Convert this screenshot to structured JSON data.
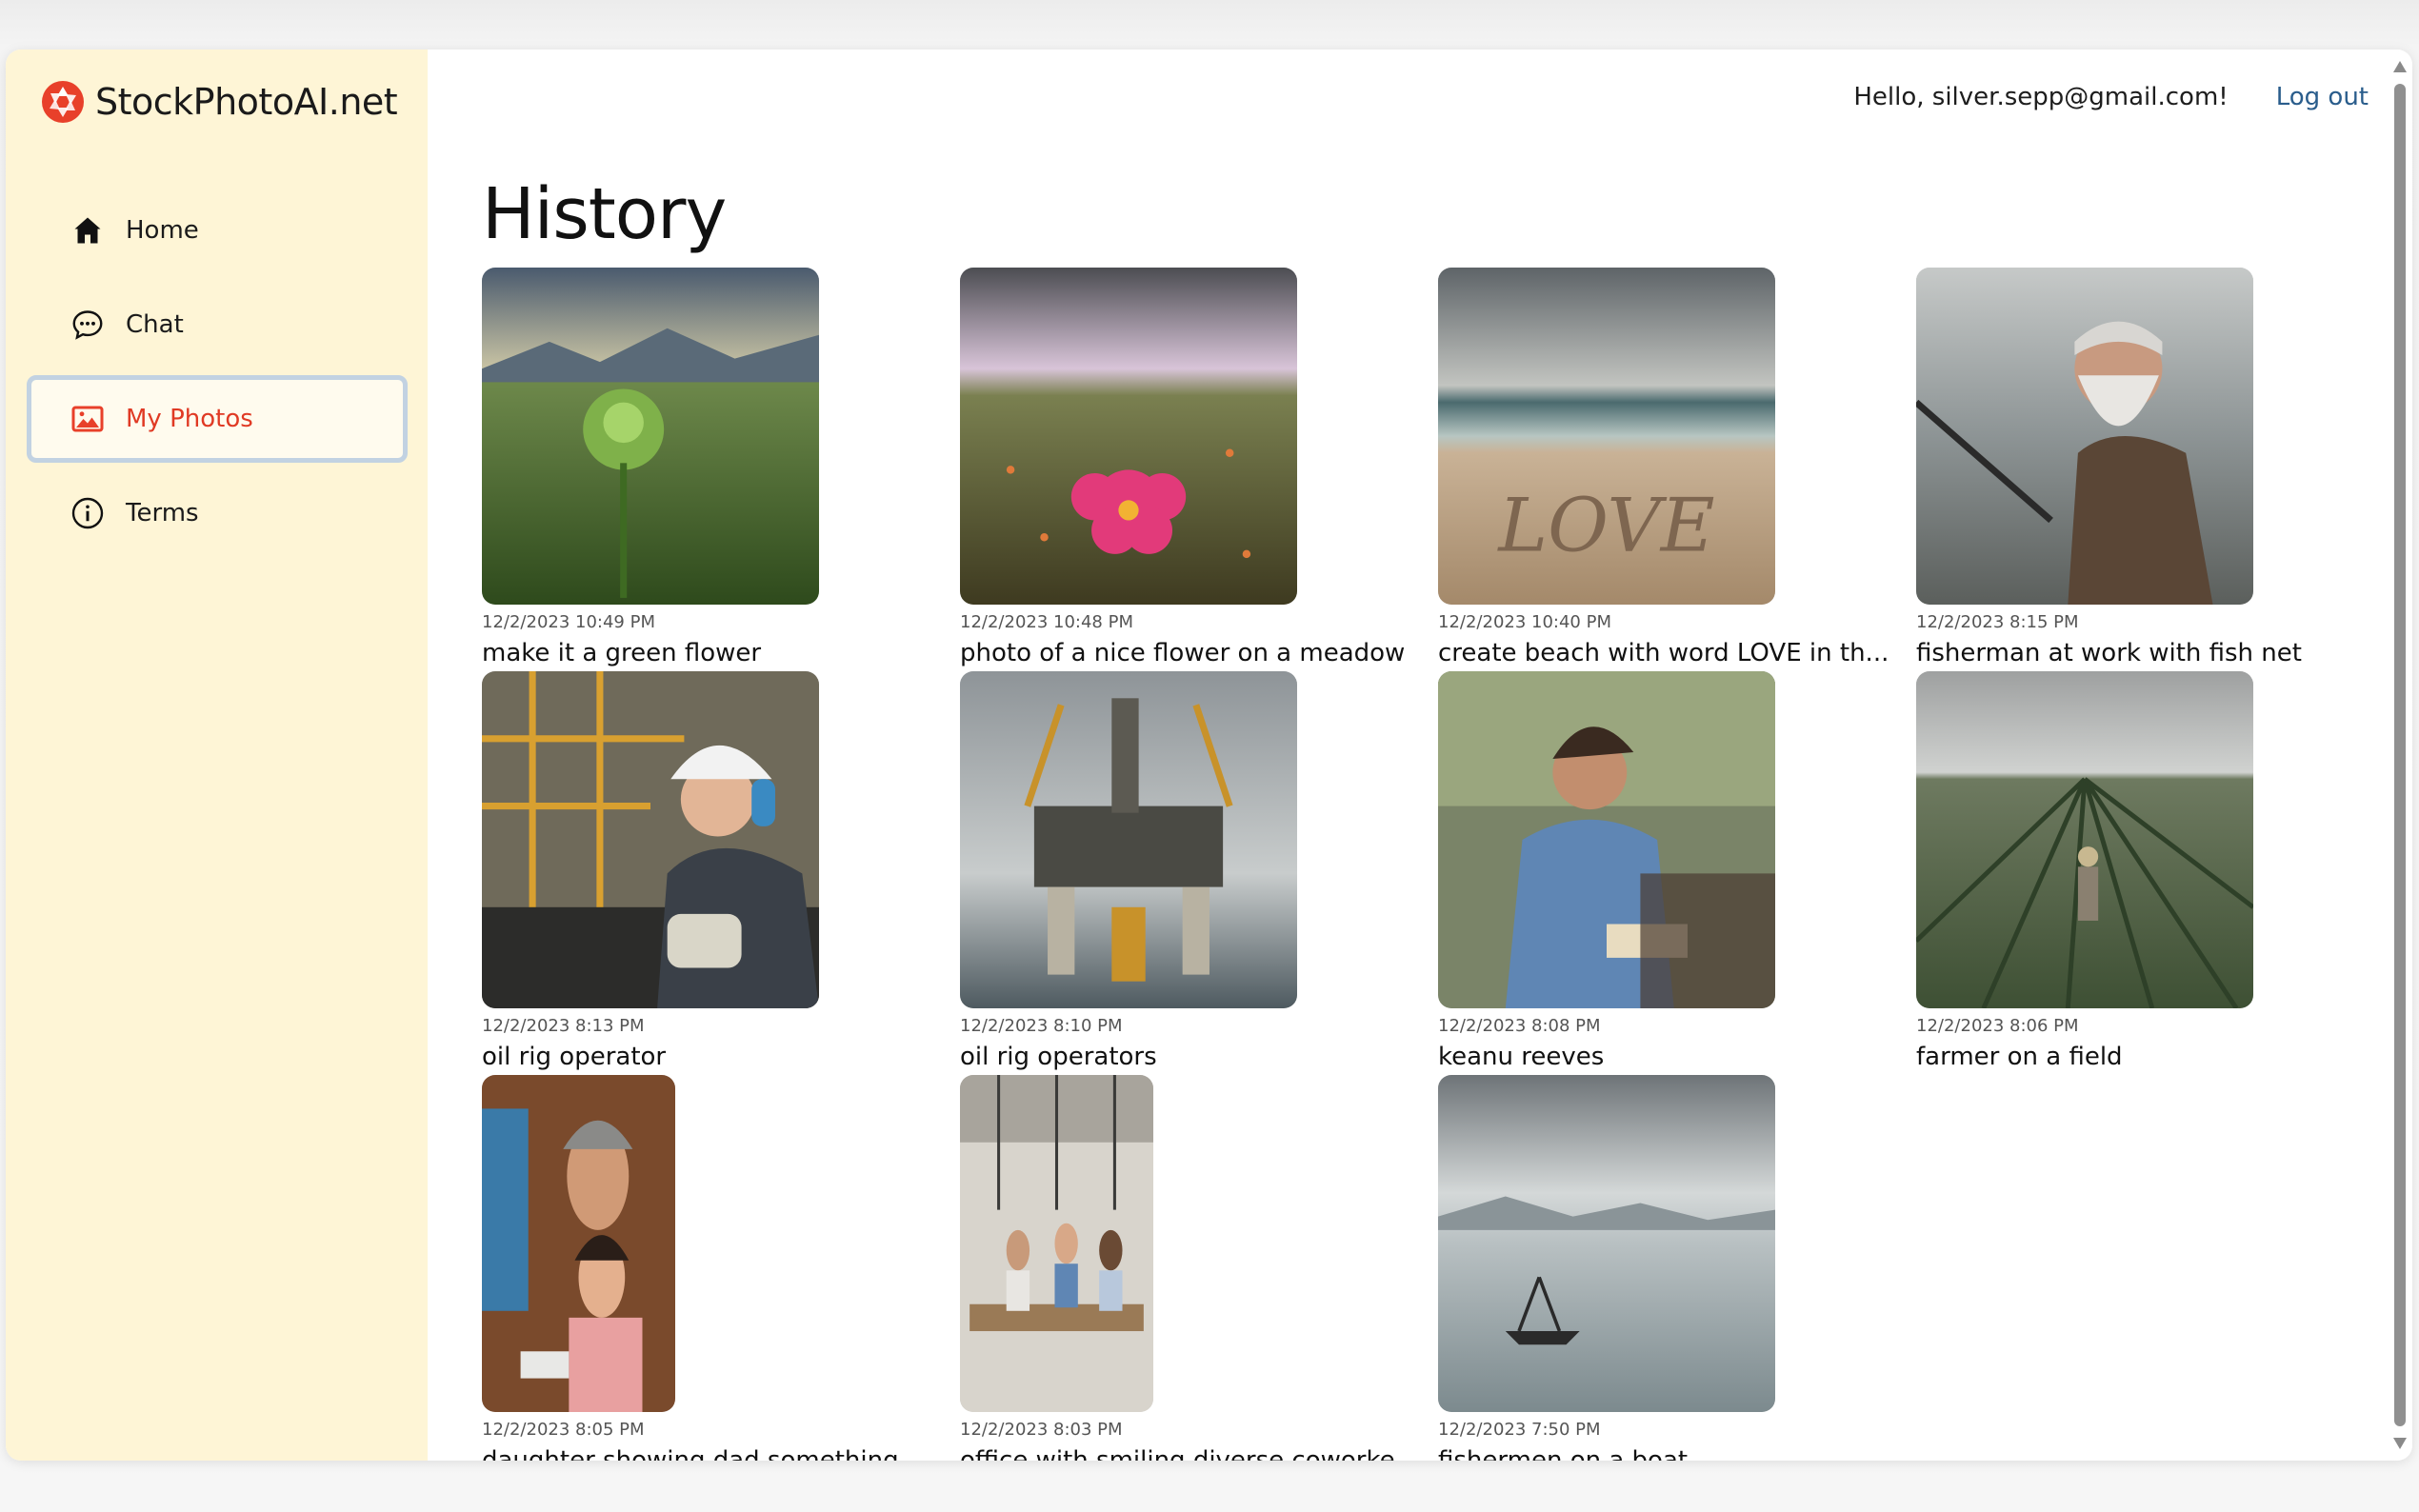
{
  "brand": {
    "name": "StockPhotoAI.net",
    "logo_icon": "aperture-logo-icon",
    "accent": "#e8402a"
  },
  "sidebar": {
    "items": [
      {
        "label": "Home",
        "icon": "home-icon",
        "active": false
      },
      {
        "label": "Chat",
        "icon": "chat-icon",
        "active": false
      },
      {
        "label": "My Photos",
        "icon": "image-icon",
        "active": true
      },
      {
        "label": "Terms",
        "icon": "info-icon",
        "active": false
      }
    ]
  },
  "header": {
    "greeting": "Hello, silver.sepp@gmail.com!",
    "logout": "Log out"
  },
  "page": {
    "title": "History"
  },
  "photos": [
    {
      "timestamp": "12/2/2023 10:49 PM",
      "prompt": "make it a green flower"
    },
    {
      "timestamp": "12/2/2023 10:48 PM",
      "prompt": "photo of a nice flower on a meadow"
    },
    {
      "timestamp": "12/2/2023 10:40 PM",
      "prompt": "create beach with word LOVE in th..."
    },
    {
      "timestamp": "12/2/2023 8:15 PM",
      "prompt": "fisherman at work with fish net"
    },
    {
      "timestamp": "12/2/2023 8:13 PM",
      "prompt": "oil rig operator"
    },
    {
      "timestamp": "12/2/2023 8:10 PM",
      "prompt": "oil rig operators"
    },
    {
      "timestamp": "12/2/2023 8:08 PM",
      "prompt": "keanu reeves"
    },
    {
      "timestamp": "12/2/2023 8:06 PM",
      "prompt": "farmer on a field"
    },
    {
      "timestamp": "12/2/2023 8:05 PM",
      "prompt": "daughter showing dad something"
    },
    {
      "timestamp": "12/2/2023 8:03 PM",
      "prompt": "office with smiling diverse coworke"
    },
    {
      "timestamp": "12/2/2023 7:50 PM",
      "prompt": "fishermen on a boat"
    }
  ]
}
